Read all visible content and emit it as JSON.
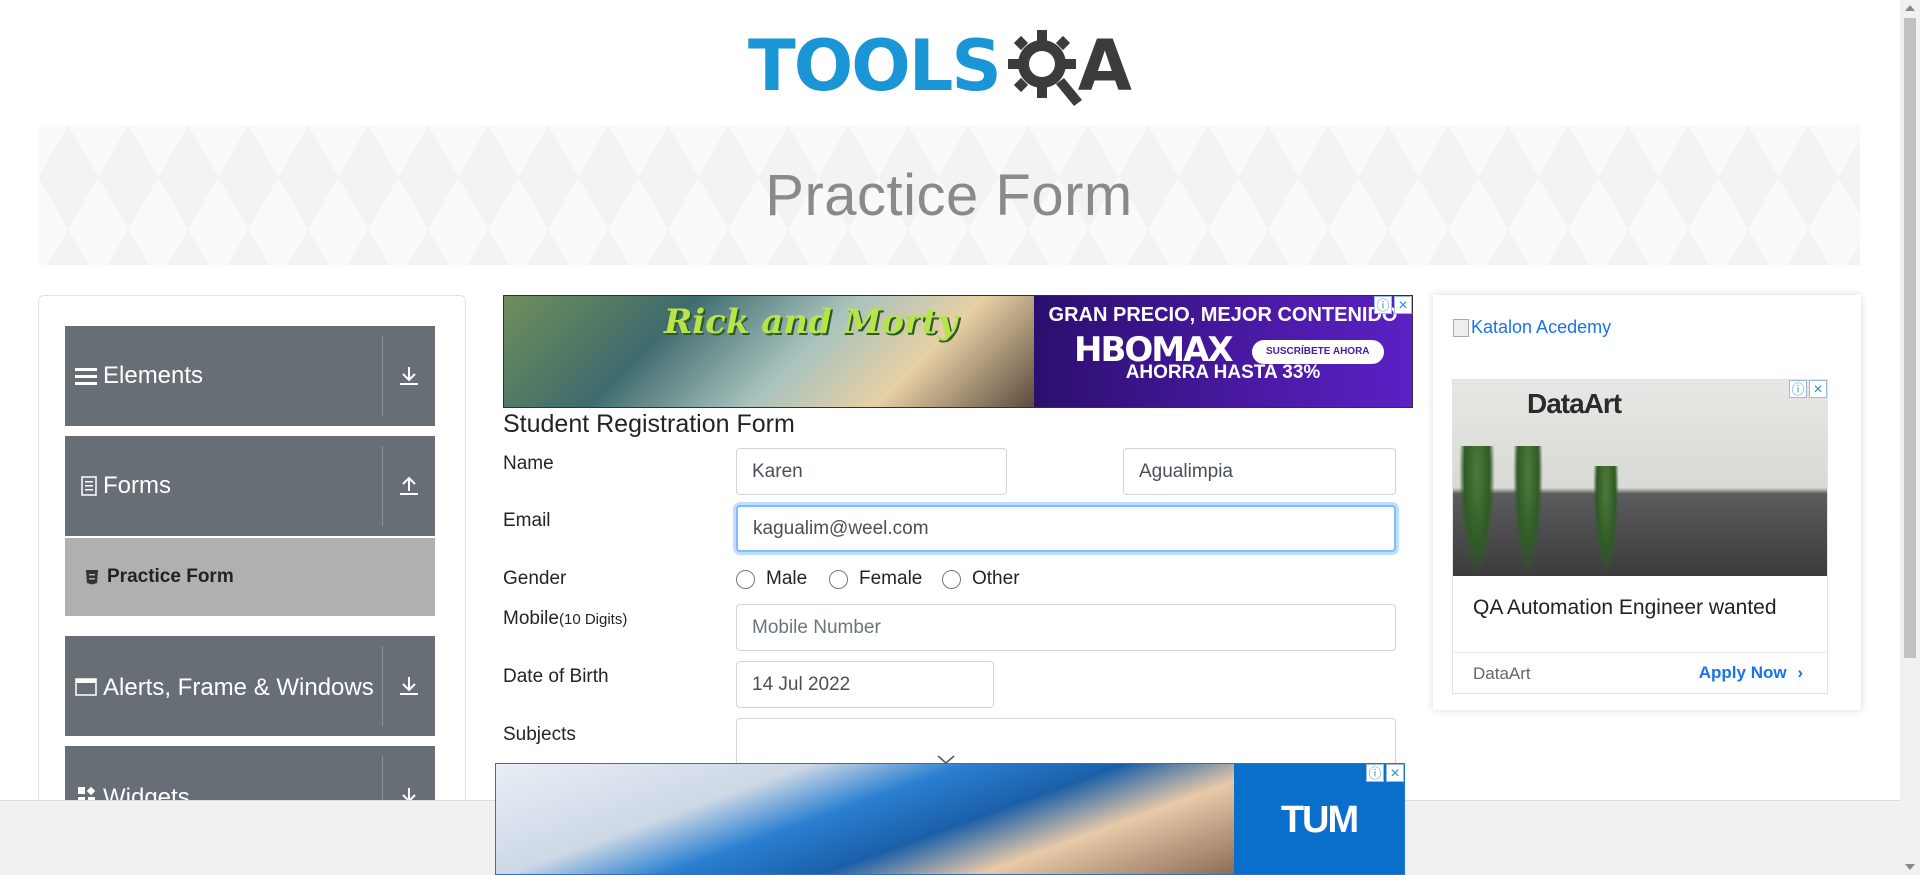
{
  "logo": {
    "text_left": "TOOLS",
    "text_right": "A"
  },
  "banner": {
    "title": "Practice Form"
  },
  "sidebar": {
    "groups": [
      {
        "label": "Elements",
        "icon": "hamburger-icon",
        "arrow": "download-icon"
      },
      {
        "label": "Forms",
        "icon": "document-icon",
        "arrow": "upload-icon"
      },
      {
        "label": "Alerts, Frame & Windows",
        "icon": "window-icon",
        "arrow": "download-icon"
      },
      {
        "label": "Widgets",
        "icon": "widgets-icon",
        "arrow": "download-icon"
      }
    ],
    "active_item": {
      "label": "Practice Form",
      "icon": "html-icon"
    }
  },
  "ads": {
    "top": {
      "left_title": "Rick and Morty",
      "headline": "GRAN PRECIO, MEJOR CONTENIDO",
      "brand": "HBOMAX",
      "cta": "SUSCRÍBETE AHORA",
      "offer": "AHORRA HASTA 33%"
    },
    "right": {
      "link_text": "Katalon Acedemy",
      "brand": "DataArt",
      "headline": "QA Automation Engineer wanted",
      "advertiser": "DataArt",
      "cta": "Apply Now"
    },
    "bottom": {
      "brand": "TUM"
    }
  },
  "form": {
    "heading": "Student Registration Form",
    "name_label": "Name",
    "first_name": "Karen",
    "last_name": "Agualimpia",
    "email_label": "Email",
    "email": "kagualim@weel.com",
    "gender_label": "Gender",
    "gender_options": [
      "Male",
      "Female",
      "Other"
    ],
    "mobile_label": "Mobile",
    "mobile_hint": "(10 Digits)",
    "mobile_placeholder": "Mobile Number",
    "dob_label": "Date of Birth",
    "dob": "14 Jul 2022",
    "subjects_label": "Subjects"
  },
  "colors": {
    "sidebar_group": "#686e75",
    "sidebar_active": "#b0b0b0",
    "logo_blue": "#1a95d6",
    "logo_dark": "#3c3c3c",
    "link_blue": "#1a73e8",
    "focus_border": "#80bdff"
  }
}
